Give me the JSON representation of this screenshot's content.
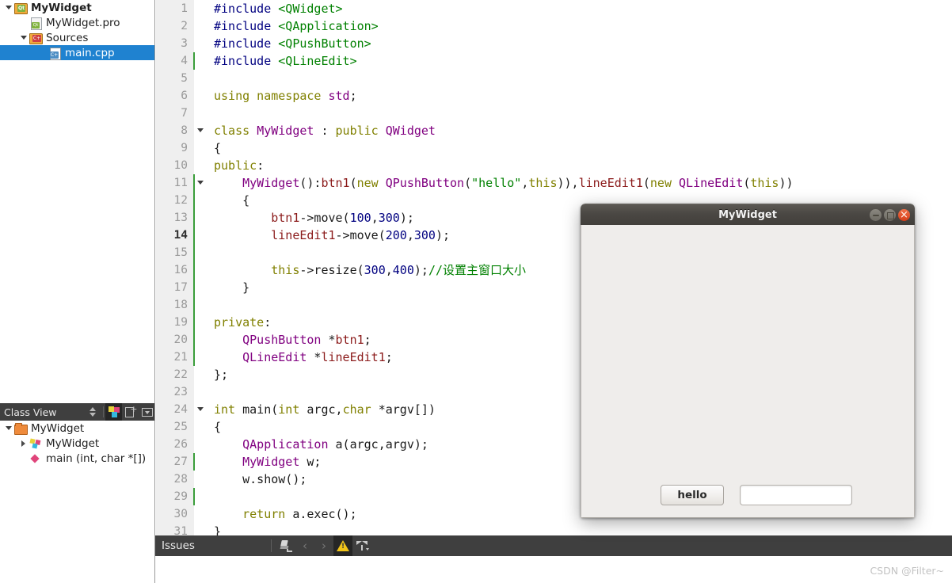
{
  "sidebar": {
    "project_tree": [
      {
        "label": "MyWidget",
        "icon": "qt-project-folder-icon",
        "indent": 0,
        "twisty": "open",
        "bold": true,
        "selected": false
      },
      {
        "label": "MyWidget.pro",
        "icon": "qt-pro-file-icon",
        "indent": 1,
        "twisty": "none",
        "bold": false,
        "selected": false
      },
      {
        "label": "Sources",
        "icon": "sources-folder-icon",
        "indent": 2,
        "twisty": "open",
        "bold": false,
        "selected": false
      },
      {
        "label": "main.cpp",
        "icon": "cpp-file-icon",
        "indent": 3,
        "twisty": "none",
        "bold": false,
        "selected": true
      }
    ],
    "class_view": {
      "title": "Class View",
      "toolbar": [
        {
          "name": "sort-toggle-button",
          "icon": "sort-arrows-icon",
          "active": false
        },
        {
          "name": "class-view-button",
          "icon": "class-glyph-icon",
          "active": true
        },
        {
          "name": "split-button",
          "icon": "split-plus-icon",
          "active": false
        },
        {
          "name": "panel-options-button",
          "icon": "dropdown-box-icon",
          "active": false
        }
      ],
      "tree": [
        {
          "label": "MyWidget",
          "icon": "folder-icon",
          "indent": 0,
          "twisty": "open",
          "bold": false
        },
        {
          "label": "MyWidget",
          "icon": "class-icon",
          "indent": 1,
          "twisty": "closed",
          "bold": false
        },
        {
          "label": "main (int, char *[])",
          "icon": "function-icon",
          "indent": 2,
          "twisty": "none",
          "bold": false
        }
      ]
    }
  },
  "editor": {
    "current_line": 14,
    "lines": [
      {
        "n": 1,
        "fold": false,
        "change": false,
        "tokens": [
          {
            "t": "#include ",
            "c": "pp"
          },
          {
            "t": "<QWidget>",
            "c": "st"
          }
        ]
      },
      {
        "n": 2,
        "fold": false,
        "change": false,
        "tokens": [
          {
            "t": "#include ",
            "c": "pp"
          },
          {
            "t": "<QApplication>",
            "c": "st"
          }
        ]
      },
      {
        "n": 3,
        "fold": false,
        "change": false,
        "tokens": [
          {
            "t": "#include ",
            "c": "pp"
          },
          {
            "t": "<QPushButton>",
            "c": "st"
          }
        ]
      },
      {
        "n": 4,
        "fold": false,
        "change": true,
        "tokens": [
          {
            "t": "#include ",
            "c": "pp"
          },
          {
            "t": "<QLineEdit>",
            "c": "st"
          }
        ]
      },
      {
        "n": 5,
        "fold": false,
        "change": false,
        "tokens": []
      },
      {
        "n": 6,
        "fold": false,
        "change": false,
        "tokens": [
          {
            "t": "using namespace ",
            "c": "k"
          },
          {
            "t": "std",
            "c": "ty"
          },
          {
            "t": ";",
            "c": "pl"
          }
        ]
      },
      {
        "n": 7,
        "fold": false,
        "change": false,
        "tokens": []
      },
      {
        "n": 8,
        "fold": true,
        "change": false,
        "tokens": [
          {
            "t": "class ",
            "c": "k"
          },
          {
            "t": "MyWidget",
            "c": "ty"
          },
          {
            "t": " : ",
            "c": "pl"
          },
          {
            "t": "public ",
            "c": "k"
          },
          {
            "t": "QWidget",
            "c": "ty"
          }
        ]
      },
      {
        "n": 9,
        "fold": false,
        "change": false,
        "tokens": [
          {
            "t": "{",
            "c": "pl"
          }
        ]
      },
      {
        "n": 10,
        "fold": false,
        "change": false,
        "tokens": [
          {
            "t": "public",
            "c": "k"
          },
          {
            "t": ":",
            "c": "pl"
          }
        ]
      },
      {
        "n": 11,
        "fold": true,
        "change": true,
        "tokens": [
          {
            "t": "    ",
            "c": "pl"
          },
          {
            "t": "MyWidget",
            "c": "ty"
          },
          {
            "t": "():",
            "c": "pl"
          },
          {
            "t": "btn1",
            "c": "fd"
          },
          {
            "t": "(",
            "c": "pl"
          },
          {
            "t": "new ",
            "c": "k"
          },
          {
            "t": "QPushButton",
            "c": "ty"
          },
          {
            "t": "(",
            "c": "pl"
          },
          {
            "t": "\"hello\"",
            "c": "st"
          },
          {
            "t": ",",
            "c": "pl"
          },
          {
            "t": "this",
            "c": "k"
          },
          {
            "t": ")),",
            "c": "pl"
          },
          {
            "t": "lineEdit1",
            "c": "fd"
          },
          {
            "t": "(",
            "c": "pl"
          },
          {
            "t": "new ",
            "c": "k"
          },
          {
            "t": "QLineEdit",
            "c": "ty"
          },
          {
            "t": "(",
            "c": "pl"
          },
          {
            "t": "this",
            "c": "k"
          },
          {
            "t": "))",
            "c": "pl"
          }
        ]
      },
      {
        "n": 12,
        "fold": false,
        "change": true,
        "tokens": [
          {
            "t": "    {",
            "c": "pl"
          }
        ]
      },
      {
        "n": 13,
        "fold": false,
        "change": true,
        "tokens": [
          {
            "t": "        ",
            "c": "pl"
          },
          {
            "t": "btn1",
            "c": "fd"
          },
          {
            "t": "->move(",
            "c": "pl"
          },
          {
            "t": "100",
            "c": "nu"
          },
          {
            "t": ",",
            "c": "pl"
          },
          {
            "t": "300",
            "c": "nu"
          },
          {
            "t": ");",
            "c": "pl"
          }
        ]
      },
      {
        "n": 14,
        "fold": false,
        "change": true,
        "tokens": [
          {
            "t": "        ",
            "c": "pl"
          },
          {
            "t": "lineEdit1",
            "c": "fd"
          },
          {
            "t": "->move(",
            "c": "pl"
          },
          {
            "t": "200",
            "c": "nu"
          },
          {
            "t": ",",
            "c": "pl"
          },
          {
            "t": "300",
            "c": "nu"
          },
          {
            "t": ");",
            "c": "pl"
          }
        ]
      },
      {
        "n": 15,
        "fold": false,
        "change": true,
        "tokens": []
      },
      {
        "n": 16,
        "fold": false,
        "change": true,
        "tokens": [
          {
            "t": "        ",
            "c": "pl"
          },
          {
            "t": "this",
            "c": "k"
          },
          {
            "t": "->resize(",
            "c": "pl"
          },
          {
            "t": "300",
            "c": "nu"
          },
          {
            "t": ",",
            "c": "pl"
          },
          {
            "t": "400",
            "c": "nu"
          },
          {
            "t": ");",
            "c": "pl"
          },
          {
            "t": "//设置主窗口大小",
            "c": "cm"
          }
        ]
      },
      {
        "n": 17,
        "fold": false,
        "change": true,
        "tokens": [
          {
            "t": "    }",
            "c": "pl"
          }
        ]
      },
      {
        "n": 18,
        "fold": false,
        "change": true,
        "tokens": []
      },
      {
        "n": 19,
        "fold": false,
        "change": true,
        "tokens": [
          {
            "t": "private",
            "c": "k"
          },
          {
            "t": ":",
            "c": "pl"
          }
        ]
      },
      {
        "n": 20,
        "fold": false,
        "change": true,
        "tokens": [
          {
            "t": "    ",
            "c": "pl"
          },
          {
            "t": "QPushButton",
            "c": "ty"
          },
          {
            "t": " *",
            "c": "pl"
          },
          {
            "t": "btn1",
            "c": "fd"
          },
          {
            "t": ";",
            "c": "pl"
          }
        ]
      },
      {
        "n": 21,
        "fold": false,
        "change": true,
        "tokens": [
          {
            "t": "    ",
            "c": "pl"
          },
          {
            "t": "QLineEdit",
            "c": "ty"
          },
          {
            "t": " *",
            "c": "pl"
          },
          {
            "t": "lineEdit1",
            "c": "fd"
          },
          {
            "t": ";",
            "c": "pl"
          }
        ]
      },
      {
        "n": 22,
        "fold": false,
        "change": false,
        "tokens": [
          {
            "t": "};",
            "c": "pl"
          }
        ]
      },
      {
        "n": 23,
        "fold": false,
        "change": false,
        "tokens": []
      },
      {
        "n": 24,
        "fold": true,
        "change": false,
        "tokens": [
          {
            "t": "int ",
            "c": "k"
          },
          {
            "t": "main",
            "c": "pl"
          },
          {
            "t": "(",
            "c": "pl"
          },
          {
            "t": "int ",
            "c": "k"
          },
          {
            "t": "argc",
            "c": "pl"
          },
          {
            "t": ",",
            "c": "pl"
          },
          {
            "t": "char ",
            "c": "k"
          },
          {
            "t": "*argv[])",
            "c": "pl"
          }
        ]
      },
      {
        "n": 25,
        "fold": false,
        "change": false,
        "tokens": [
          {
            "t": "{",
            "c": "pl"
          }
        ]
      },
      {
        "n": 26,
        "fold": false,
        "change": false,
        "tokens": [
          {
            "t": "    ",
            "c": "pl"
          },
          {
            "t": "QApplication",
            "c": "ty"
          },
          {
            "t": " a(argc,argv);",
            "c": "pl"
          }
        ]
      },
      {
        "n": 27,
        "fold": false,
        "change": true,
        "tokens": [
          {
            "t": "    ",
            "c": "pl"
          },
          {
            "t": "MyWidget",
            "c": "ty"
          },
          {
            "t": " w;",
            "c": "pl"
          }
        ]
      },
      {
        "n": 28,
        "fold": false,
        "change": false,
        "tokens": [
          {
            "t": "    w.show();",
            "c": "pl"
          }
        ]
      },
      {
        "n": 29,
        "fold": false,
        "change": true,
        "tokens": []
      },
      {
        "n": 30,
        "fold": false,
        "change": false,
        "tokens": [
          {
            "t": "    ",
            "c": "pl"
          },
          {
            "t": "return ",
            "c": "k"
          },
          {
            "t": "a.exec();",
            "c": "pl"
          }
        ]
      },
      {
        "n": 31,
        "fold": false,
        "change": false,
        "tokens": [
          {
            "t": "}",
            "c": "pl"
          }
        ]
      }
    ]
  },
  "issues": {
    "label": "Issues",
    "buttons": [
      {
        "name": "clear-issues-button",
        "icon": "broom-icon",
        "active": false
      },
      {
        "name": "previous-issue-button",
        "icon": "chevron-left-icon",
        "active": false
      },
      {
        "name": "next-issue-button",
        "icon": "chevron-right-icon",
        "active": false
      },
      {
        "name": "warnings-filter-button",
        "icon": "warning-triangle-icon",
        "active": true
      },
      {
        "name": "filter-button",
        "icon": "funnel-icon",
        "active": false
      }
    ],
    "chevron_left": "‹",
    "chevron_right": "›"
  },
  "qt_dialog": {
    "title": "MyWidget",
    "window_buttons": [
      "minimize",
      "maximize",
      "close"
    ],
    "hello_button_label": "hello",
    "line_edit_value": "",
    "line_edit_placeholder": ""
  },
  "watermark": "CSDN @Filter~",
  "colors": {
    "selection_blue": "#1f82d0",
    "panel_dark": "#3f3f3f",
    "gutter_gray": "#efefef",
    "change_marker_green": "#3a9e3a",
    "dialog_body": "#efedeb",
    "close_button_orange": "#d63d18",
    "warning_yellow": "#f0c419",
    "keyword_olive": "#808000",
    "type_purple": "#800080",
    "string_green": "#008000",
    "preprocessor_navy": "#000080",
    "field_dark_red": "#8b1a1a"
  }
}
